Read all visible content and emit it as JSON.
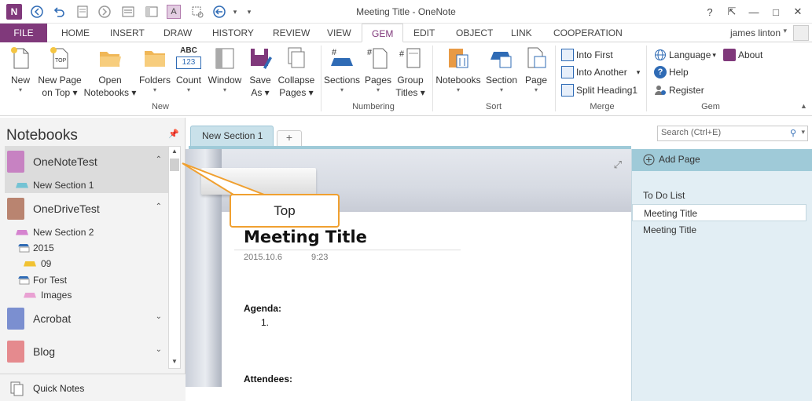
{
  "window": {
    "title": "Meeting Title - OneNote",
    "app_logo": "N"
  },
  "titlebar_controls": {
    "help": "?",
    "restore_ribbon": "⇱",
    "minimize": "—",
    "maximize": "□",
    "close": "✕"
  },
  "user": {
    "name": "james linton"
  },
  "tabs": [
    "FILE",
    "HOME",
    "INSERT",
    "DRAW",
    "HISTORY",
    "REVIEW",
    "VIEW",
    "GEM",
    "EDIT",
    "OBJECT",
    "LINK",
    "COOPERATION"
  ],
  "active_tab": "GEM",
  "ribbon": {
    "new_group": {
      "label": "New",
      "buttons": [
        {
          "line1": "New",
          "line2": ""
        },
        {
          "line1": "New Page",
          "line2": "on Top"
        },
        {
          "line1": "Open",
          "line2": "Notebooks"
        },
        {
          "line1": "Folders",
          "line2": ""
        },
        {
          "line1": "Count",
          "line2": ""
        },
        {
          "line1": "Window",
          "line2": ""
        },
        {
          "line1": "Save",
          "line2": "As"
        },
        {
          "line1": "Collapse",
          "line2": "Pages"
        }
      ],
      "count_icon_text": "ABC",
      "count_icon_num": "123"
    },
    "numbering_group": {
      "label": "Numbering",
      "buttons": [
        {
          "line1": "Sections",
          "line2": ""
        },
        {
          "line1": "Pages",
          "line2": ""
        },
        {
          "line1": "Group",
          "line2": "Titles"
        }
      ]
    },
    "sort_group": {
      "label": "Sort",
      "buttons": [
        {
          "line1": "Notebooks",
          "line2": ""
        },
        {
          "line1": "Section",
          "line2": ""
        },
        {
          "line1": "Page",
          "line2": ""
        }
      ]
    },
    "merge_group": {
      "label": "Merge",
      "items": [
        "Into First",
        "Into Another",
        "Split Heading1"
      ]
    },
    "gem_group": {
      "label": "Gem",
      "items": [
        "Language",
        "About",
        "Help",
        "Register"
      ]
    }
  },
  "notebooks": {
    "title": "Notebooks",
    "list": [
      {
        "name": "OneNoteTest",
        "color": "#c782c2"
      },
      {
        "name": "OneDriveTest",
        "color": "#b98470"
      },
      {
        "name": "Acrobat",
        "color": "#7b8fd0"
      },
      {
        "name": "Blog",
        "color": "#e58a8e"
      }
    ],
    "sections": {
      "s1": "New Section 1",
      "s2": "New Section 2",
      "g2015": "2015",
      "s09": "09",
      "gfortest": "For Test",
      "simages": "Images"
    },
    "quick_notes": "Quick Notes"
  },
  "section_tab": {
    "label": "New Section 1",
    "add": "+"
  },
  "search": {
    "placeholder": "Search (Ctrl+E)"
  },
  "page": {
    "title": "Meeting Title",
    "date": "2015.10.6",
    "time": "9:23",
    "agenda": "Agenda:",
    "list_item": "1.",
    "attendees": "Attendees:"
  },
  "callout": {
    "text": "Top"
  },
  "page_list": {
    "add_page": "Add Page",
    "pages": [
      "To Do List",
      "Meeting Title",
      "Meeting Title"
    ],
    "selected_index": 1
  },
  "colors": {
    "accent": "#80397b",
    "section_tab": "#9fcad8",
    "callout_border": "#f0a030"
  }
}
